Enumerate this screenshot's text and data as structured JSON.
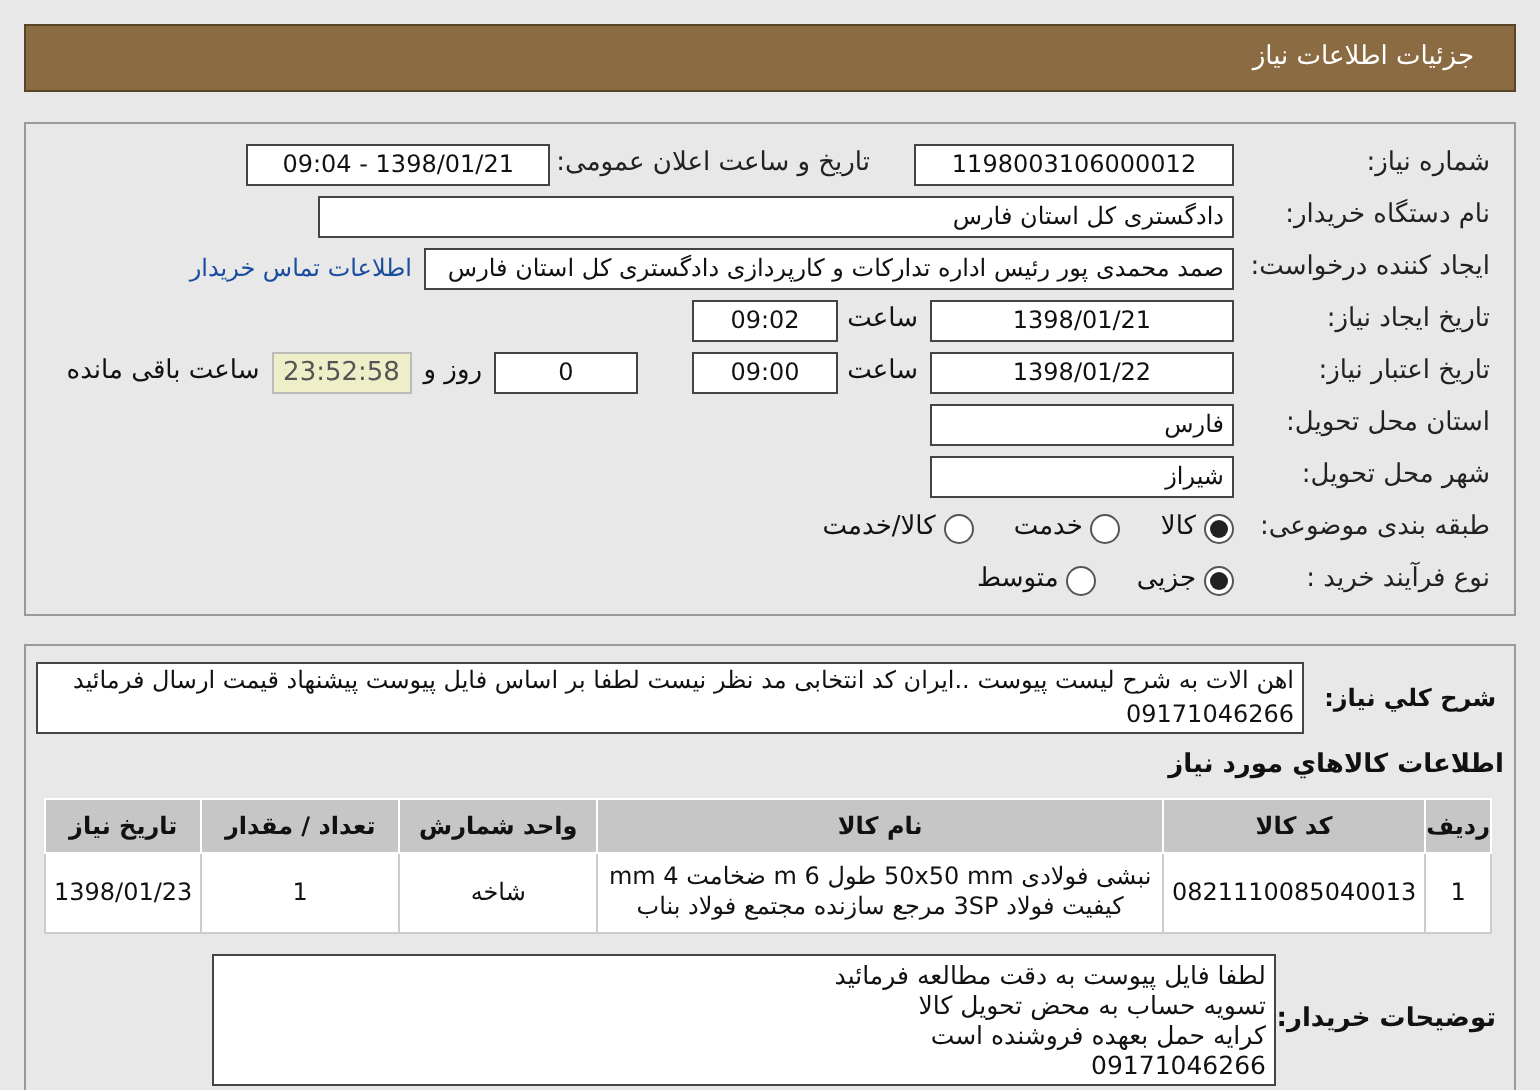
{
  "header": {
    "title": "جزئیات اطلاعات نیاز"
  },
  "details": {
    "need_number": {
      "label": "شماره نیاز:",
      "value": "1198003106000012"
    },
    "announce": {
      "label": "تاریخ و ساعت اعلان عمومی:",
      "value": "1398/01/21 - 09:04"
    },
    "buyer": {
      "label": "نام دستگاه خریدار:",
      "value": "دادگستری کل استان فارس"
    },
    "creator": {
      "label": "ایجاد کننده درخواست:",
      "value": "صمد محمدی پور رئیس اداره تدارکات و کارپردازی دادگستری کل استان فارس",
      "link": "اطلاعات تماس خریدار"
    },
    "created": {
      "label": "تاریخ ایجاد نیاز:",
      "date": "1398/01/21",
      "time_label": "ساعت",
      "time": "09:02"
    },
    "validity": {
      "label": "تاریخ اعتبار نیاز:",
      "date": "1398/01/22",
      "time_label": "ساعت",
      "time": "09:00",
      "days": "0",
      "days_label": "روز و",
      "remaining": "23:52:58",
      "remaining_label": "ساعت باقی مانده"
    },
    "province": {
      "label": "استان محل تحویل:",
      "value": "فارس"
    },
    "city": {
      "label": "شهر محل تحویل:",
      "value": "شیراز"
    },
    "category": {
      "label": "طبقه بندی موضوعی:",
      "options": [
        {
          "label": "کالا",
          "selected": true
        },
        {
          "label": "خدمت",
          "selected": false
        },
        {
          "label": "کالا/خدمت",
          "selected": false
        }
      ]
    },
    "process": {
      "label": "نوع فرآیند خرید :",
      "options": [
        {
          "label": "جزیی",
          "selected": true
        },
        {
          "label": "متوسط",
          "selected": false
        }
      ]
    }
  },
  "summary": {
    "label": "شرح کلي نياز:",
    "text": "اهن الات به شرح لیست پیوست ..ایران کد انتخابی مد نظر نیست لطفا بر اساس فایل پیوست پیشنهاد قیمت ارسال فرمائید 09171046266"
  },
  "goods": {
    "title": "اطلاعات کالاهاي مورد نياز",
    "columns": [
      "ردیف",
      "کد کالا",
      "نام کالا",
      "واحد شمارش",
      "تعداد / مقدار",
      "تاریخ نیاز"
    ],
    "rows": [
      [
        "1",
        "0821110085040013",
        "نبشی فولادی 50x50 mm طول 6 m ضخامت 4 mm کیفیت فولاد 3SP مرجع سازنده مجتمع فولاد بناب",
        "شاخه",
        "1",
        "1398/01/23"
      ]
    ]
  },
  "notes": {
    "label": "توضیحات خریدار:",
    "lines": [
      "لطفا فایل پیوست به دقت مطالعه فرمائید",
      "تسویه حساب به محض تحویل کالا",
      "کرایه حمل بعهده فروشنده است",
      "09171046266"
    ]
  }
}
